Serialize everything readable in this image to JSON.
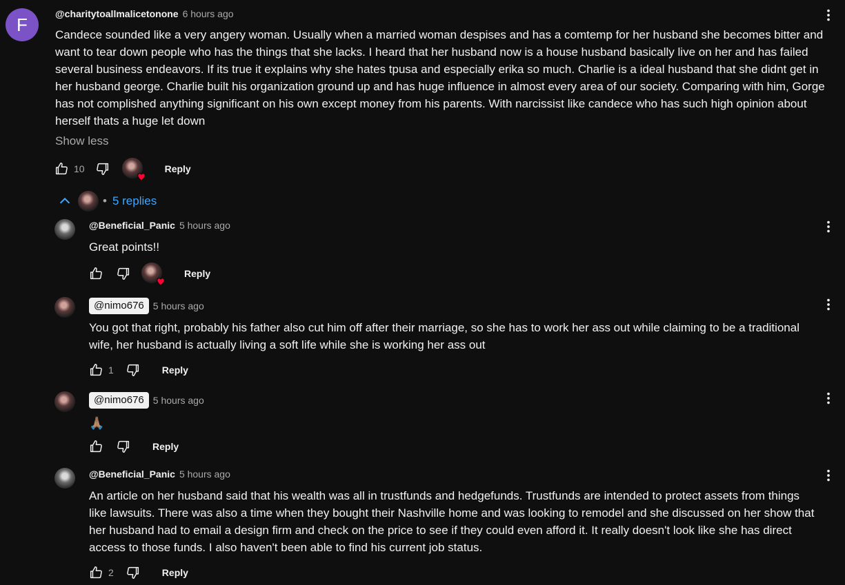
{
  "comment": {
    "avatar_letter": "F",
    "username": "@charitytoallmalicetonone",
    "time": "6 hours ago",
    "text_lines": [
      "Candece sounded like a very angery woman. Usually when a married woman despises and has a comtemp for her husband she becomes bitter and",
      "want to tear down people who has the things that she lacks. I heard that her husband now is a house husband basically live on her and has failed",
      "several business endeavors. If its true it explains why she hates tpusa and especially erika so much. Charlie is a ideal husband that she didnt get in",
      "her husband george. Charlie built his organization ground up and has huge influence in almost every area of our society. Comparing with him, Gorge",
      "has not complished anything significant on his own except money from his parents. With narcissist like candece who has such high opinion about",
      "herself thats a huge let down"
    ],
    "show_less": "Show less",
    "likes": "10",
    "reply_label": "Reply",
    "replies_count": "5 replies"
  },
  "replies": [
    {
      "username": "@Beneficial_Panic",
      "time": "5 hours ago",
      "text_lines": [
        "Great points!!"
      ],
      "likes": "",
      "reply_label": "Reply"
    },
    {
      "username": "@nimo676",
      "time": "5 hours ago",
      "text_lines": [
        "You got that right, probably his father also cut him off after their marriage, so she has to work her ass out while claiming to be a traditional",
        "wife, her husband is actually living a soft life while she is working her ass out"
      ],
      "likes": "1",
      "reply_label": "Reply"
    },
    {
      "username": "@nimo676",
      "time": "5 hours ago",
      "text_lines": [
        "🙏🏽"
      ],
      "likes": "",
      "reply_label": "Reply"
    },
    {
      "username": "@Beneficial_Panic",
      "time": "5 hours ago",
      "text_lines": [
        "An article on her husband said that his wealth was all in trustfunds and hedgefunds. Trustfunds are intended to protect assets from things",
        "like lawsuits. There was also a time when they bought their Nashville home and was looking to remodel and she discussed on her show that",
        "her husband had to email a design firm and check on the price to see if they could even afford it. It really doesn't look like she has direct",
        "access to those funds. I also haven't been able to find his current job status."
      ],
      "likes": "2",
      "reply_label": "Reply"
    }
  ],
  "colors": {
    "background": "#0f0f0f",
    "avatar": "#7b53c7",
    "link": "#3ea6ff",
    "heart": "#ff0033"
  },
  "icons": [
    "thumbs-up-icon",
    "thumbs-down-icon",
    "more-vert-icon",
    "chevron-up-icon",
    "heart-icon"
  ]
}
